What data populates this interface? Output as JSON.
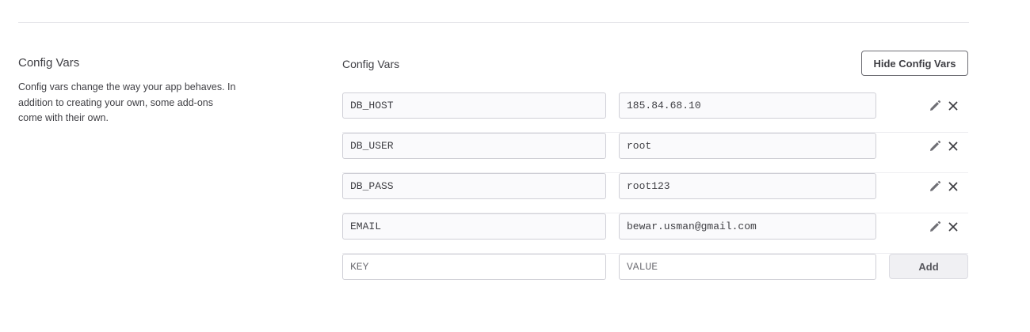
{
  "settings": {
    "title": "Config Vars",
    "description": "Config vars change the way your app behaves. In addition to creating your own, some add-ons come with their own."
  },
  "config_vars": {
    "label": "Config Vars",
    "hide_button": "Hide Config Vars",
    "rows": [
      {
        "key": "DB_HOST",
        "value": "185.84.68.10"
      },
      {
        "key": "DB_USER",
        "value": "root"
      },
      {
        "key": "DB_PASS",
        "value": "root123"
      },
      {
        "key": "EMAIL",
        "value": "bewar.usman@gmail.com"
      }
    ],
    "new_row": {
      "key_placeholder": "KEY",
      "value_placeholder": "VALUE",
      "add_button": "Add"
    },
    "icons": {
      "edit": "pencil-icon",
      "delete": "close-icon"
    }
  }
}
